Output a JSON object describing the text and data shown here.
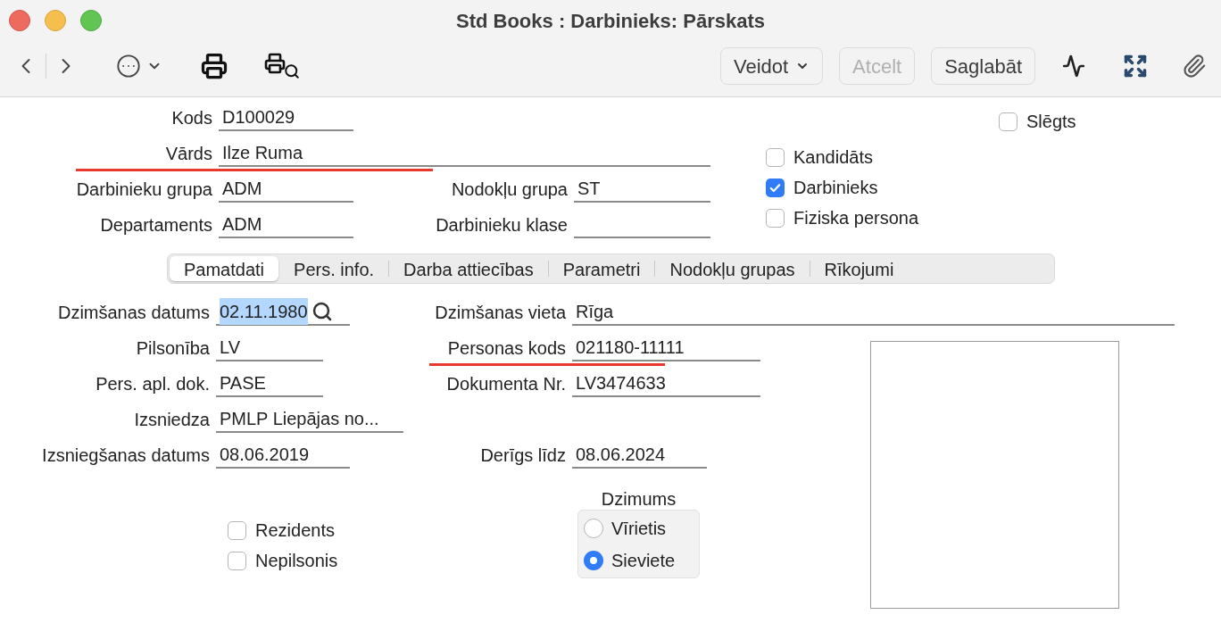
{
  "window": {
    "title": "Std Books : Darbinieks: Pārskats"
  },
  "toolbar": {
    "buttons": [
      {
        "label": "Veidot",
        "kind": "dropdown",
        "disabled": false
      },
      {
        "label": "Atcelt",
        "kind": "plain",
        "disabled": true
      },
      {
        "label": "Saglabāt",
        "kind": "plain",
        "disabled": false
      }
    ]
  },
  "header": {
    "rows": [
      {
        "fields": [
          {
            "label": "Kods",
            "value": "D100029",
            "underlined": false
          }
        ]
      },
      {
        "fields": [
          {
            "label": "Vārds",
            "value": "Ilze Ruma",
            "underlined": true
          }
        ]
      },
      {
        "fields": [
          {
            "label": "Darbinieku grupa",
            "value": "ADM",
            "underlined": false
          },
          {
            "label": "Nodokļu grupa",
            "value": "ST",
            "underlined": false
          }
        ]
      },
      {
        "fields": [
          {
            "label": "Departaments",
            "value": "ADM",
            "underlined": false
          },
          {
            "label": "Darbinieku klase",
            "underlined": false
          }
        ]
      }
    ],
    "checkboxes": [
      {
        "label": "Slēgts",
        "checked": false
      },
      {
        "label": "Kandidāts",
        "checked": false
      },
      {
        "label": "Darbinieks",
        "checked": true
      },
      {
        "label": "Fiziska persona",
        "checked": false
      }
    ]
  },
  "tabs": [
    {
      "label": "Pamatdati",
      "selected": true
    },
    {
      "label": "Pers. info.",
      "selected": false
    },
    {
      "label": "Darba attiecības",
      "selected": false
    },
    {
      "label": "Parametri",
      "selected": false
    },
    {
      "label": "Nodokļu grupas",
      "selected": false
    },
    {
      "label": "Rīkojumi",
      "selected": false
    }
  ],
  "details": {
    "rows": [
      {
        "fields": [
          {
            "label": "Dzimšanas datums",
            "value": "02.11.1980",
            "underlined": false,
            "text_selected": true,
            "lookup": true
          },
          {
            "label": "Dzimšanas vieta",
            "value": "Rīga",
            "underlined": false
          }
        ]
      },
      {
        "fields": [
          {
            "label": "Pilsonība",
            "value": "LV",
            "underlined": false
          },
          {
            "label": "Personas kods",
            "value": "021180-11111",
            "underlined": true
          }
        ]
      },
      {
        "fields": [
          {
            "label": "Pers. apl. dok.",
            "value": "PASE",
            "underlined": false
          },
          {
            "label": "Dokumenta Nr.",
            "value": "LV3474633",
            "underlined": false
          }
        ]
      },
      {
        "fields": [
          {
            "label": "Izsniedza",
            "value": "PMLP Liepājas no...",
            "underlined": false
          }
        ]
      },
      {
        "fields": [
          {
            "label": "Izsniegšanas datums",
            "value": "08.06.2019",
            "underlined": false
          },
          {
            "label": "Derīgs līdz",
            "value": "08.06.2024",
            "underlined": false
          }
        ]
      }
    ],
    "checkboxes": [
      {
        "label": "Rezidents",
        "checked": false
      },
      {
        "label": "Nepilsonis",
        "checked": false
      }
    ],
    "gender": {
      "label": "Dzimums",
      "options": [
        {
          "label": "Vīrietis",
          "selected": false
        },
        {
          "label": "Sieviete",
          "selected": true
        }
      ]
    }
  }
}
